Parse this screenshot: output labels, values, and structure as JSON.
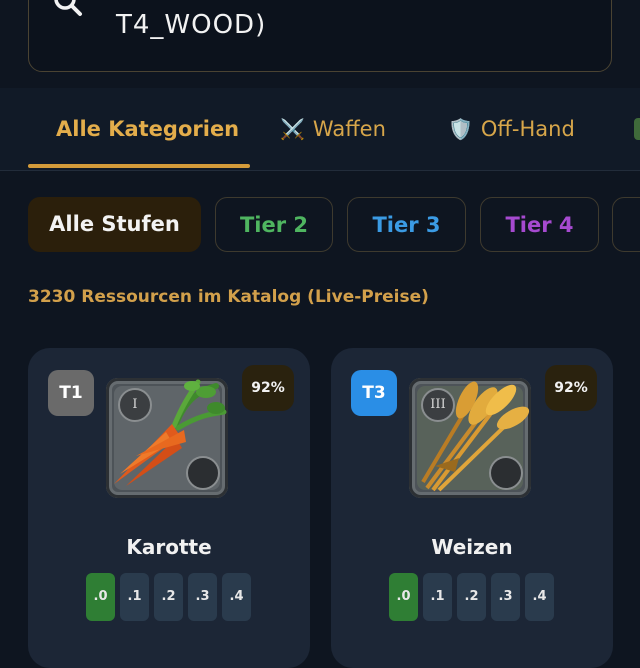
{
  "search": {
    "value": "T4_WOOD)"
  },
  "tabs": [
    {
      "label": "Alle Kategorien",
      "icon": "",
      "active": true
    },
    {
      "label": "Waffen",
      "icon": "⚔️",
      "active": false
    },
    {
      "label": "Off-Hand",
      "icon": "🛡️",
      "active": false
    }
  ],
  "tiers": [
    {
      "label": "Alle Stufen",
      "color": "#f3f3f3"
    },
    {
      "label": "Tier 2",
      "color": "#4fb560"
    },
    {
      "label": "Tier 3",
      "color": "#3b9be4"
    },
    {
      "label": "Tier 4",
      "color": "#a64ad0"
    }
  ],
  "catalog_info": "3230 Ressourcen im Katalog (Live-Preise)",
  "items": [
    {
      "tier": "T1",
      "tier_color": "#6a6a6a",
      "roman": "I",
      "percent": "92%",
      "name": "Karotte",
      "icon": "carrot-icon",
      "enchants": [
        ".0",
        ".1",
        ".2",
        ".3",
        ".4"
      ],
      "selected_enchant": ".0"
    },
    {
      "tier": "T3",
      "tier_color": "#2a8ee6",
      "roman": "III",
      "percent": "92%",
      "name": "Weizen",
      "icon": "wheat-icon",
      "enchants": [
        ".0",
        ".1",
        ".2",
        ".3",
        ".4"
      ],
      "selected_enchant": ".0"
    }
  ]
}
